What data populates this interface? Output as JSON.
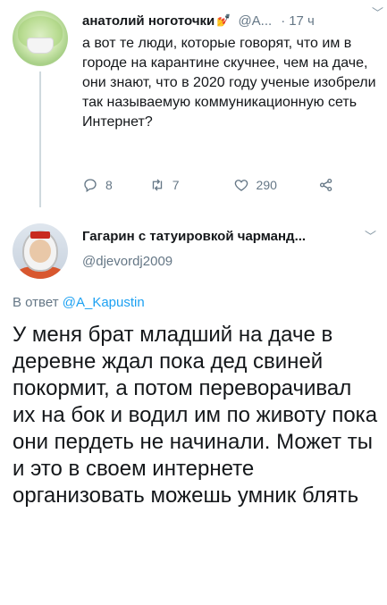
{
  "tweet1": {
    "author_name": "анатолий ноготочки",
    "author_emoji": "💅",
    "handle": "@A...",
    "dot": "·",
    "time": "17 ч",
    "caret": "﹀",
    "body": "а вот те люди, которые говорят, что им в городе на карантине скучнее, чем на даче, они знают, что в 2020 году ученые изобрели так называемую коммуникационную сеть Интернет?",
    "actions": {
      "reply_count": "8",
      "retweet_count": "7",
      "like_count": "290"
    }
  },
  "tweet2": {
    "author_name": "Гагарин с татуировкой чарманд...",
    "handle": "@djevordj2009",
    "caret": "﹀",
    "reply_prefix": "В ответ",
    "reply_mention": "@A_Kapustin",
    "body": "У меня брат младший на даче в деревне ждал пока дед свиней покормит, а потом переворачивал их на бок и водил им по животу пока они пердеть не начинали. Может ты и это в своем интернете организовать можешь умник блять"
  },
  "colors": {
    "text": "#14171a",
    "muted": "#657786",
    "link": "#1da1f2",
    "thread_line": "#cfd9de"
  }
}
